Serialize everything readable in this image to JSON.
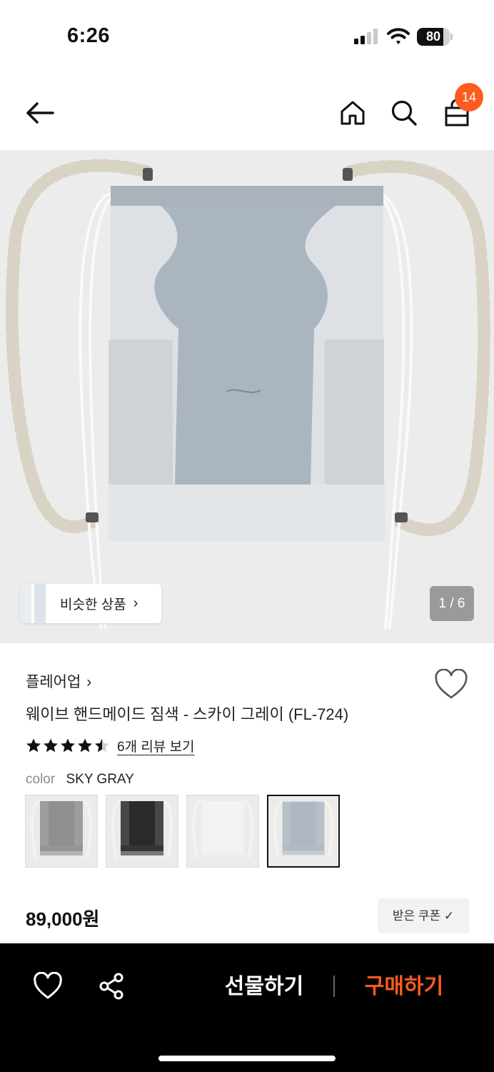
{
  "status_bar": {
    "time": "6:26",
    "battery_level": "80",
    "battery_fraction": 0.8,
    "icons": [
      "signal-icon",
      "wifi-icon",
      "battery-icon"
    ]
  },
  "header": {
    "icons": [
      "back-arrow-icon",
      "home-icon",
      "search-icon",
      "shopping-bag-icon"
    ],
    "cart_count": "14",
    "badge_color": "#ff5a1f"
  },
  "gallery": {
    "similar_products_label": "비슷한 상품",
    "similar_chevron": "›",
    "page_indicator": "1 / 6"
  },
  "product": {
    "brand": "플레어업",
    "brand_chevron": "›",
    "title": "웨이브 핸드메이드 짐색 - 스카이 그레이 (FL-724)",
    "rating": 4.5,
    "review_link": "6개 리뷰 보기",
    "color_label": "color",
    "color_value": "SKY GRAY",
    "swatches": [
      {
        "name": "gray",
        "color": "#8f8f8f"
      },
      {
        "name": "black",
        "color": "#2a2a2a"
      },
      {
        "name": "white",
        "color": "#f3f3f3"
      },
      {
        "name": "sky gray",
        "color": "#aeb8c2",
        "selected": true
      }
    ],
    "price": "89,000원",
    "coupon_label": "받은 쿠폰 ✓"
  },
  "bottom_bar": {
    "icons": [
      "heart-icon",
      "share-icon"
    ],
    "gift_label": "선물하기",
    "buy_label": "구매하기",
    "accent_color": "#ff5a1f"
  }
}
